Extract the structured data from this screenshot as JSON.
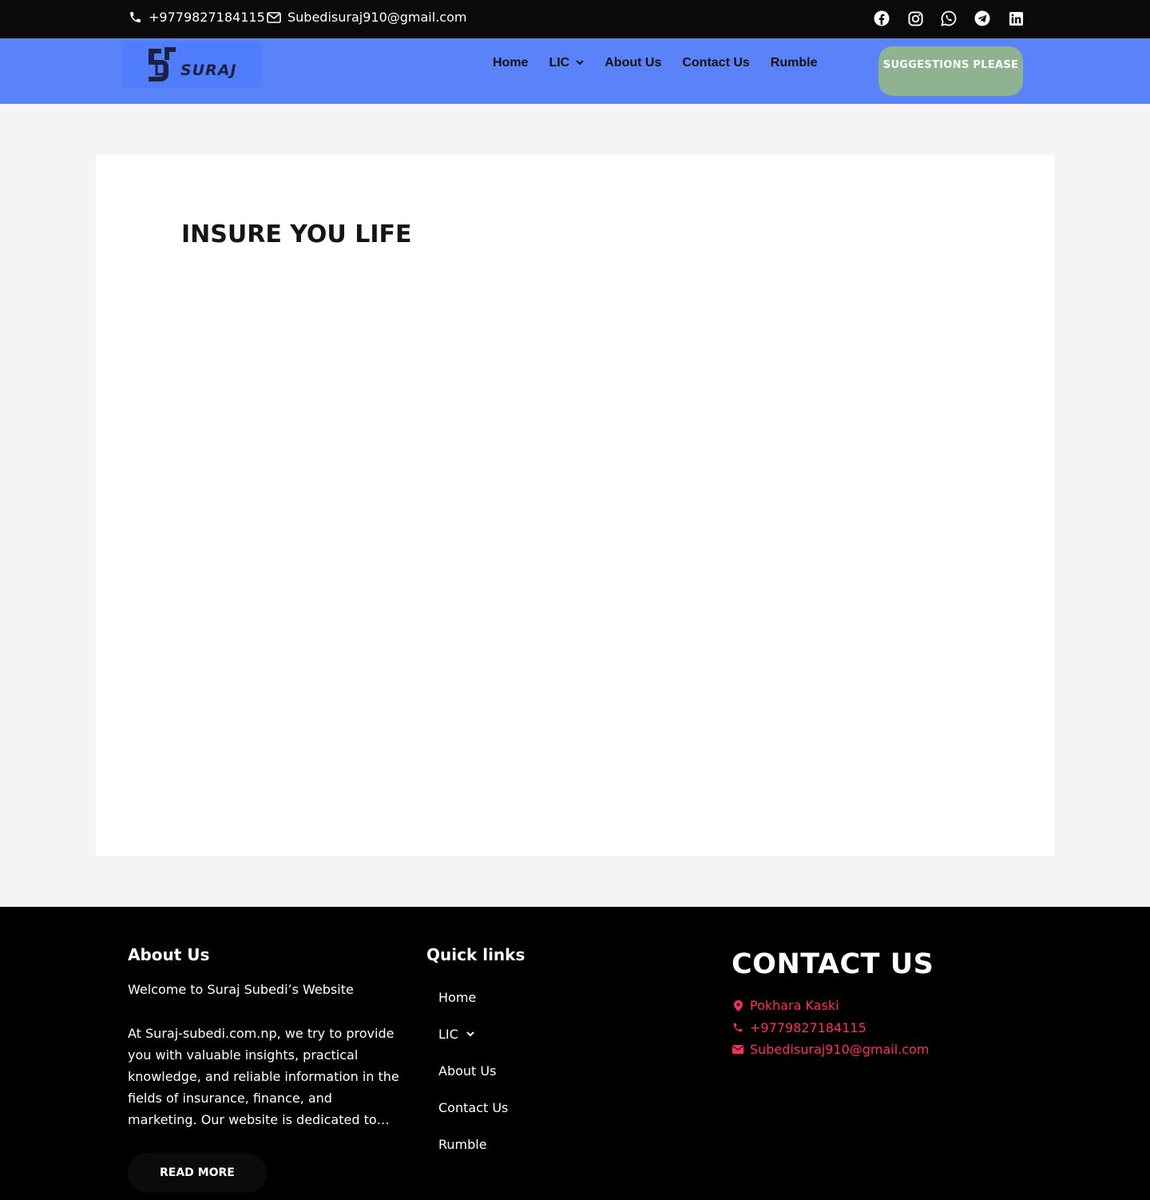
{
  "topbar": {
    "phone": "+9779827184115",
    "email": "Subedisuraj910@gmail.com",
    "social": [
      "facebook-icon",
      "instagram-icon",
      "whatsapp-icon",
      "telegram-icon",
      "linkedin-icon"
    ]
  },
  "header": {
    "logo_text": "SURAJ",
    "nav": [
      {
        "label": "Home",
        "has_dropdown": false
      },
      {
        "label": "LIC",
        "has_dropdown": true
      },
      {
        "label": "About Us",
        "has_dropdown": false
      },
      {
        "label": "Contact Us",
        "has_dropdown": false
      },
      {
        "label": "Rumble",
        "has_dropdown": false
      }
    ],
    "cta_label": "SUGGESTIONS PLEASE"
  },
  "main": {
    "title": "INSURE YOU LIFE"
  },
  "footer": {
    "about": {
      "heading": "About Us",
      "welcome": "Welcome to Suraj Subedi’s  Website",
      "body": "At Suraj-subedi.com.np, we try to provide you with valuable insights, practical knowledge, and reliable information in the fields of insurance, finance, and marketing. Our website is dedicated to…",
      "button": "READ MORE"
    },
    "links": {
      "heading": "Quick links",
      "items": [
        "Home",
        "LIC",
        "About Us",
        "Contact Us",
        "Rumble"
      ]
    },
    "contact": {
      "heading": "CONTACT US",
      "location": "Pokhara Kaski",
      "phone": "+9779827184115",
      "email": "Subedisuraj910@gmail.com"
    }
  },
  "colors": {
    "topbar_bg": "#0a0a0a",
    "nav_bg": "#5b83f9",
    "cta_bg": "#8fb391",
    "footer_bg": "#000000",
    "contact_accent": "#ff2d5a"
  }
}
